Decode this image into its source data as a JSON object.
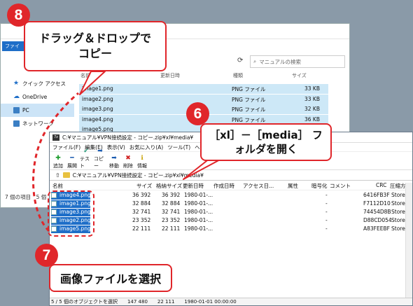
{
  "explorer": {
    "ribbon_tab": "ファイル",
    "search_placeholder": "マニュアルの検索",
    "nav": [
      {
        "label": "クイック アクセス"
      },
      {
        "label": "OneDrive"
      },
      {
        "label": "PC"
      },
      {
        "label": "ネットワーク"
      }
    ],
    "columns": {
      "name": "名前",
      "date": "更新日時",
      "type": "種類",
      "size": "サイズ"
    },
    "files": [
      {
        "name": "image1.png",
        "type": "PNG ファイル",
        "size": "33 KB"
      },
      {
        "name": "image2.png",
        "type": "PNG ファイル",
        "size": "33 KB"
      },
      {
        "name": "image3.png",
        "type": "PNG ファイル",
        "size": "32 KB"
      },
      {
        "name": "image4.png",
        "type": "PNG ファイル",
        "size": "36 KB"
      },
      {
        "name": "image5.png",
        "type": "PNG ファイル",
        "size": ""
      }
    ],
    "status": "7 個の項目　5 個"
  },
  "archive": {
    "title": "C:¥マニュアル¥VPN接続設定 - コピー.zip¥xl¥media¥",
    "menu": [
      "ファイル(F)",
      "編集(E)",
      "表示(V)",
      "お気に入り(A)",
      "ツール(T)",
      "ヘルプ(H)"
    ],
    "toolbar": [
      {
        "label": "追加",
        "icon": "plus-icon",
        "glyph": "✚",
        "color": "#1a9a2a"
      },
      {
        "label": "展開",
        "icon": "minus-icon",
        "glyph": "━",
        "color": "#1a5bb0"
      },
      {
        "label": "テスト",
        "icon": "check-icon",
        "glyph": "✔",
        "color": "#2a9a7a"
      },
      {
        "label": "コピー",
        "icon": "arrow-right-icon",
        "glyph": "➡",
        "color": "#1a5bb0"
      },
      {
        "label": "移動",
        "icon": "arrow-right-icon",
        "glyph": "➡",
        "color": "#1a5bb0"
      },
      {
        "label": "削除",
        "icon": "delete-x-icon",
        "glyph": "✖",
        "color": "#d02020"
      },
      {
        "label": "情報",
        "icon": "info-icon",
        "glyph": "ℹ",
        "color": "#c8a000"
      }
    ],
    "path": "C:¥マニュアル¥VPN接続設定 - コピー.zip¥xl¥media¥",
    "columns": [
      "名前",
      "サイズ",
      "格納サイズ",
      "更新日時",
      "作成日時",
      "アクセス日...",
      "属性",
      "暗号化",
      "コメント",
      "CRC",
      "圧縮方式"
    ],
    "files": [
      {
        "name": "image4.png",
        "size": "36 392",
        "packed": "36 392",
        "modified": "1980-01-...",
        "encrypted": "-",
        "crc": "6416FB3F",
        "method": "Store"
      },
      {
        "name": "image1.png",
        "size": "32 884",
        "packed": "32 884",
        "modified": "1980-01-...",
        "encrypted": "-",
        "crc": "F7112D10",
        "method": "Store"
      },
      {
        "name": "image3.png",
        "size": "32 741",
        "packed": "32 741",
        "modified": "1980-01-...",
        "encrypted": "-",
        "crc": "74454D8B",
        "method": "Store"
      },
      {
        "name": "image2.png",
        "size": "23 352",
        "packed": "23 352",
        "modified": "1980-01-...",
        "encrypted": "-",
        "crc": "D88CD054",
        "method": "Store"
      },
      {
        "name": "image5.png",
        "size": "22 111",
        "packed": "22 111",
        "modified": "1980-01-...",
        "encrypted": "-",
        "crc": "A83FEEBF",
        "method": "Store"
      }
    ],
    "status": {
      "selection": "5 / 5 個のオブジェクトを選択",
      "size": "147 480",
      "packed": "22 111",
      "date": "1980-01-01 00:00:00"
    }
  },
  "callouts": {
    "step8_number": "8",
    "step8_text": "ドラッグ＆ドロップで コピー",
    "step6_number": "6",
    "step6_text": "［xl］－［media］ フォルダを開く",
    "step7_number": "7",
    "step7_text": "画像ファイルを選択"
  },
  "colors": {
    "accent": "#e0262a",
    "selection": "#1e6ec8"
  }
}
